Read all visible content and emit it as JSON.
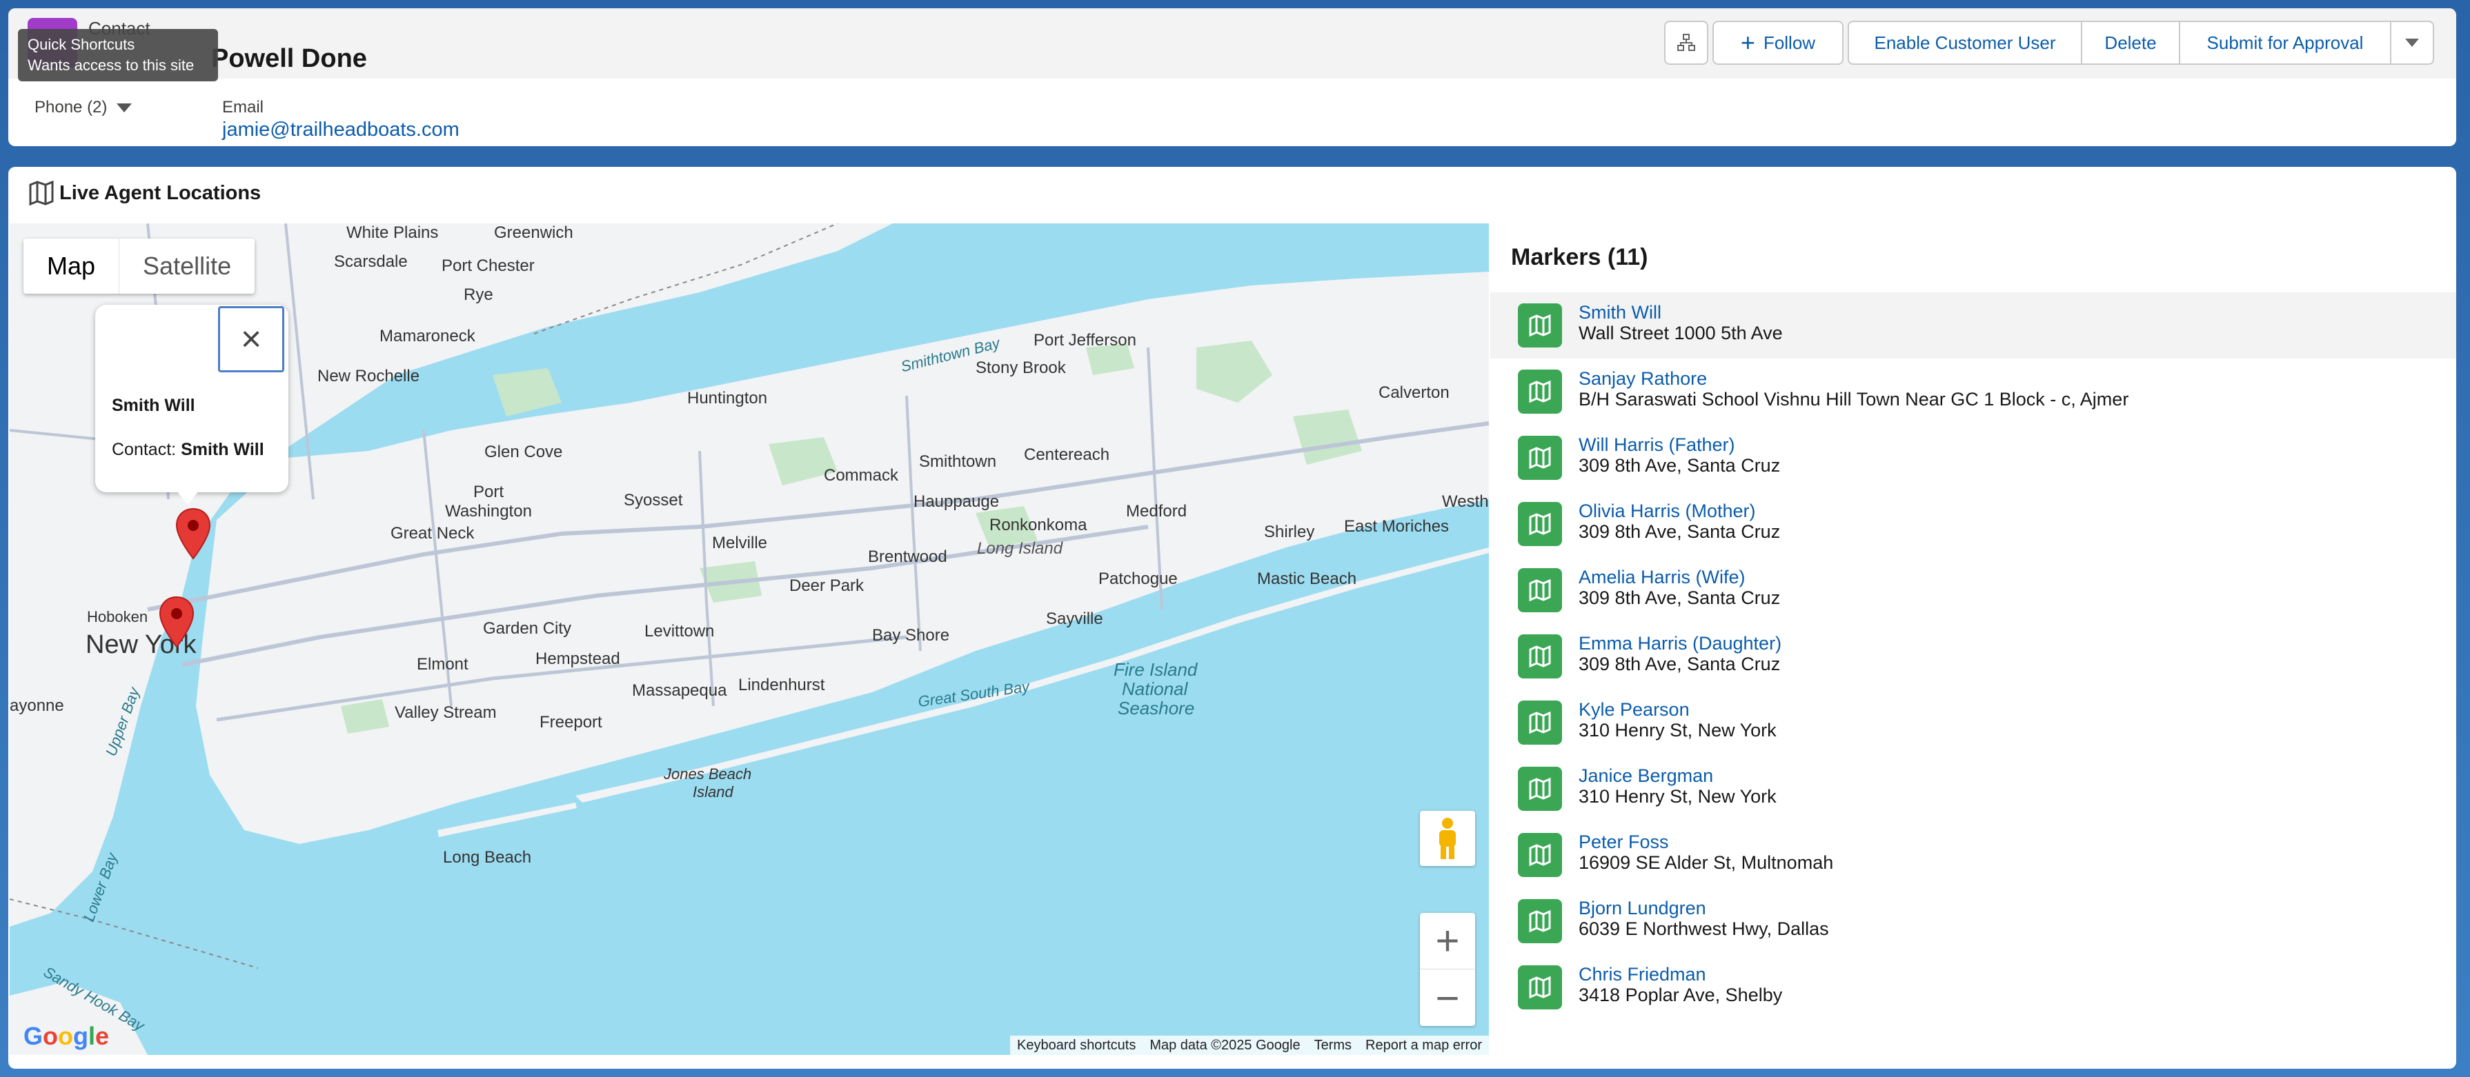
{
  "header": {
    "object_type": "Contact",
    "record_name": "Powell Done",
    "tooltip_line1": "Quick Shortcuts",
    "tooltip_line2": "Wants access to this site",
    "actions": {
      "follow": "Follow",
      "enable_customer_user": "Enable Customer User",
      "delete": "Delete",
      "submit_for_approval": "Submit for Approval"
    },
    "phone_label": "Phone (2)",
    "email_label": "Email",
    "email_value": "jamie@trailheadboats.com"
  },
  "card": {
    "title": "Live Agent Locations"
  },
  "map": {
    "type_map": "Map",
    "type_satellite": "Satellite",
    "info_window": {
      "title": "Smith Will",
      "contact_label": "Contact:",
      "contact_value": "Smith Will"
    },
    "footer": {
      "keyboard": "Keyboard shortcuts",
      "data": "Map data ©2025 Google",
      "terms": "Terms",
      "report": "Report a map error"
    },
    "labels": {
      "new_york": "New York",
      "long_island": "Long Island",
      "fire_island": "Fire Island",
      "national": "National",
      "seashore": "Seashore",
      "great_south_bay": "Great South Bay",
      "smithtown_bay": "Smithtown Bay",
      "huntington": "Huntington",
      "brentwood": "Brentwood",
      "hempstead": "Hempstead",
      "long_beach": "Long Beach",
      "new_rochelle": "New Rochelle",
      "patchogue": "Patchogue",
      "medford": "Medford",
      "melville": "Melville",
      "hauppauge": "Hauppauge",
      "glen_cove": "Glen Cove",
      "levittown": "Levittown",
      "freeport": "Freeport",
      "hoboken": "Hoboken",
      "bay_shore": "Bay Shore",
      "smithtown": "Smithtown",
      "stony_brook": "Stony Brook",
      "port_jefferson": "Port Jefferson",
      "calverton": "Calverton",
      "shirley": "Shirley",
      "mastic_beach": "Mastic Beach",
      "sayville": "Sayville",
      "lindenhurst": "Lindenhurst",
      "massapequa": "Massapequa",
      "valley_stream": "Valley Stream",
      "elmont": "Elmont",
      "garden_city": "Garden City",
      "syosset": "Syosset",
      "commack": "Commack",
      "deer_park": "Deer Park",
      "centereach": "Centereach",
      "ronkonkoma": "Ronkonkoma",
      "great_neck": "Great Neck",
      "port_washington": "Port Washington",
      "mamaroneck": "Mamaroneck",
      "port_chester": "Port Chester",
      "rye": "Rye",
      "scarsdale": "Scarsdale",
      "white_plains": "White Plains",
      "greenwich": "Greenwich",
      "jones_beach": "Jones Beach",
      "island": "Island",
      "east_moriches": "East Moriches",
      "bayonne": "ayonne",
      "upper_bay": "Upper Bay",
      "lower_bay": "Lower Bay",
      "sandy_hook_bay": "Sandy Hook Bay",
      "westh": "Westh"
    }
  },
  "markers": {
    "title": "Markers (11)",
    "items": [
      {
        "name": "Smith Will",
        "address": "Wall Street 1000 5th Ave"
      },
      {
        "name": "Sanjay Rathore",
        "address": "B/H Saraswati School Vishnu Hill Town Near GC 1 Block - c, Ajmer"
      },
      {
        "name": "Will Harris (Father)",
        "address": "309 8th Ave, Santa Cruz"
      },
      {
        "name": "Olivia Harris (Mother)",
        "address": "309 8th Ave, Santa Cruz"
      },
      {
        "name": "Amelia Harris (Wife)",
        "address": "309 8th Ave, Santa Cruz"
      },
      {
        "name": "Emma Harris (Daughter)",
        "address": "309 8th Ave, Santa Cruz"
      },
      {
        "name": "Kyle Pearson",
        "address": "310 Henry St, New York"
      },
      {
        "name": "Janice Bergman",
        "address": "310 Henry St, New York"
      },
      {
        "name": "Peter Foss",
        "address": "16909 SE Alder St, Multnomah"
      },
      {
        "name": "Bjorn Lundgren",
        "address": "6039 E Northwest Hwy, Dallas"
      },
      {
        "name": "Chris Friedman",
        "address": "3418 Poplar Ave, Shelby"
      }
    ]
  },
  "colors": {
    "brand_blue": "#0b5cab",
    "marker_green": "#3ba755",
    "water": "#9cdcf0",
    "land": "#f1f3f4",
    "pin_red": "#e53935"
  }
}
